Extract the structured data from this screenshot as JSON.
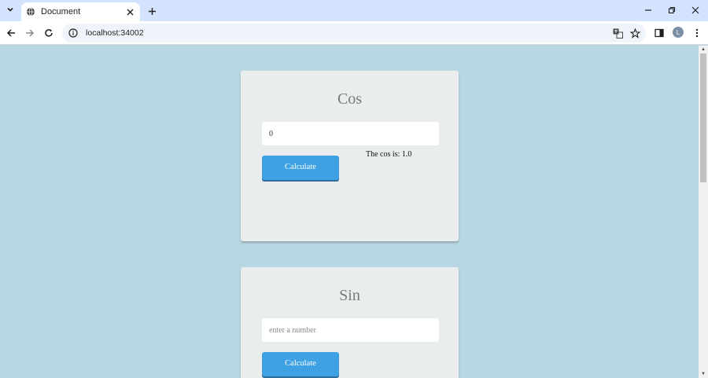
{
  "browser": {
    "tab_title": "Document",
    "url": "localhost:34002",
    "profile_initial": "L",
    "icons": {
      "tab_search": "chevron-down-icon",
      "favicon": "globe-icon",
      "tab_close": "close-icon",
      "new_tab": "plus-icon",
      "back": "arrow-left-icon",
      "forward": "arrow-right-icon",
      "reload": "reload-icon",
      "site_info": "info-icon",
      "translate": "translate-icon",
      "bookmark": "star-icon",
      "side_panel": "side-panel-icon",
      "menu": "more-vertical-icon",
      "minimize": "minimize-icon",
      "restore": "restore-icon",
      "close": "close-icon"
    }
  },
  "cos_card": {
    "title": "Cos",
    "input_value": "0",
    "button_label": "Calculate",
    "result_text": "The cos is: 1.0"
  },
  "sin_card": {
    "title": "Sin",
    "input_placeholder": "enter a number",
    "button_label": "Calculate"
  },
  "colors": {
    "page_background": "#b9d6e3",
    "card_background": "#e9edee",
    "button_blue": "#3da1e3",
    "title_gray": "#7a7a7a"
  }
}
